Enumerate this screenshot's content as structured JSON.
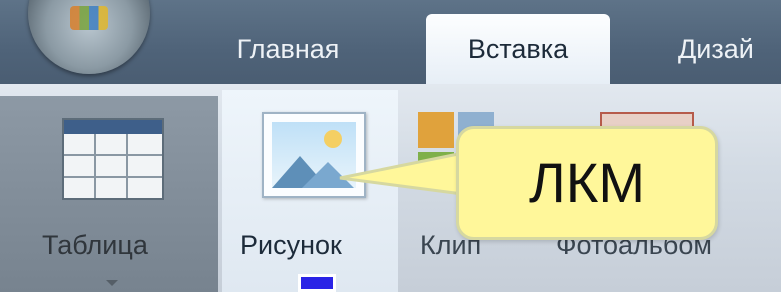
{
  "tabs": {
    "home": "Главная",
    "insert": "Вставка",
    "design": "Дизай"
  },
  "ribbon": {
    "table_label": "Таблица",
    "picture_label": "Рисунок",
    "clip_label": "Клип",
    "photoalbum_label": "Фотоальбом"
  },
  "annotation": {
    "callout_text": "ЛКМ"
  },
  "colors": {
    "tab_bar": "#5e7388",
    "active_tab": "#fdfeff",
    "callout_fill": "#fff79a",
    "cursor_marker": "#2a23e6"
  },
  "icons": {
    "orb": "office-orb-icon",
    "table": "table-icon",
    "picture": "picture-icon",
    "clip": "clip-art-icon",
    "shapes": "shapes-icon"
  }
}
